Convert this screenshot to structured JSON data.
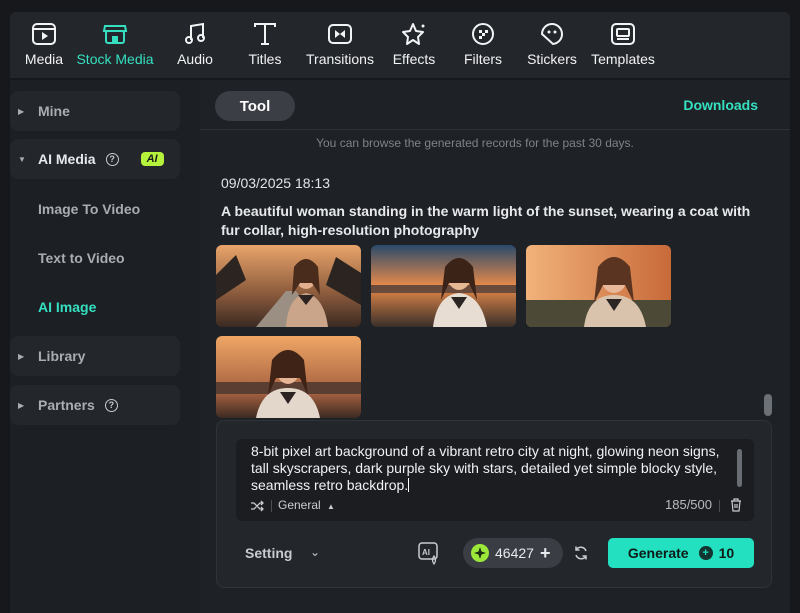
{
  "toolbar": {
    "items": [
      {
        "label": "Media",
        "icon": "media-icon"
      },
      {
        "label": "Stock Media",
        "icon": "store-icon",
        "active": true
      },
      {
        "label": "Audio",
        "icon": "music-note-icon"
      },
      {
        "label": "Titles",
        "icon": "text-t-icon"
      },
      {
        "label": "Transitions",
        "icon": "transition-icon"
      },
      {
        "label": "Effects",
        "icon": "effects-star-icon"
      },
      {
        "label": "Filters",
        "icon": "filter-icon"
      },
      {
        "label": "Stickers",
        "icon": "sticker-icon"
      },
      {
        "label": "Templates",
        "icon": "template-icon"
      }
    ]
  },
  "sidebar": {
    "mine": "Mine",
    "ai_media": "AI Media",
    "ai_badge": "AI",
    "ai_sub": [
      "Image To Video",
      "Text to Video",
      "AI Image"
    ],
    "library": "Library",
    "partners": "Partners"
  },
  "main": {
    "tab": "Tool",
    "downloads": "Downloads",
    "notice": "You can browse the generated records for the past 30 days.",
    "record": {
      "time": "09/03/2025 18:13",
      "prompt": "A beautiful woman standing in the warm light of the sunset, wearing a coat with fur collar, high-resolution photography"
    }
  },
  "composer": {
    "prompt": "8-bit pixel art background of a vibrant retro city at night, glowing neon signs, tall skyscrapers, dark purple sky with stars, detailed yet simple blocky style, seamless retro backdrop.",
    "style": "General",
    "count": "185/500",
    "setting": "Setting",
    "credits": "46427",
    "generate_label": "Generate",
    "generate_cost": "10"
  },
  "colors": {
    "accent": "#35e0c1",
    "button": "#22e0c0",
    "badge": "#b5f23b"
  }
}
